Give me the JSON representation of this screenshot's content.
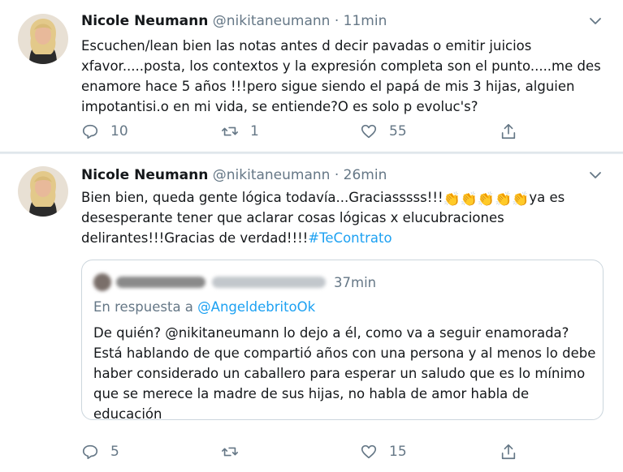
{
  "tweets": [
    {
      "author_name": "Nicole Neumann",
      "handle": "@nikitaneumann",
      "separator": "·",
      "time": "11min",
      "text": "Escuchen/lean bien las notas antes d decir pavadas o emitir juicios xfavor.....posta, los contextos y la expresión completa son el punto.....me des enamore hace 5 años !!!pero sigue siendo el papá de mis 3 hijas, alguien impotantisi.o en mi vida, se entiende?O es solo p evoluc's?",
      "reply_count": "10",
      "retweet_count": "1",
      "like_count": "55"
    },
    {
      "author_name": "Nicole Neumann",
      "handle": "@nikitaneumann",
      "separator": "·",
      "time": "26min",
      "text_before": "Bien bien, queda gente lógica todavía...Graciasssss!!!",
      "claps": "👏👏👏👏👏",
      "text_after": "ya es desesperante tener que aclarar cosas lógicas x elucubraciones delirantes!!!Gracias de verdad!!!!",
      "hashtag": "#TeContrato",
      "reply_count": "5",
      "retweet_count": "",
      "like_count": "15",
      "quote": {
        "time": "37min",
        "reply_prefix": "En respuesta a",
        "reply_to": "@AngeldebritoOk",
        "text": "De quién? @nikitaneumann lo dejo a él, como va a seguir enamorada? Está hablando de que compartió años con una persona y al menos lo debe haber considerado un caballero para esperar un saludo que es lo mínimo que se merece la madre de sus hijas, no habla de amor habla de educación"
      }
    }
  ],
  "icons": {
    "reply": "reply-icon",
    "retweet": "retweet-icon",
    "like": "heart-icon",
    "share": "share-icon",
    "caret": "chevron-down-icon"
  },
  "colors": {
    "link": "#1da1f2",
    "muted": "#657786",
    "text": "#14171a",
    "border": "#ccd6dd"
  }
}
